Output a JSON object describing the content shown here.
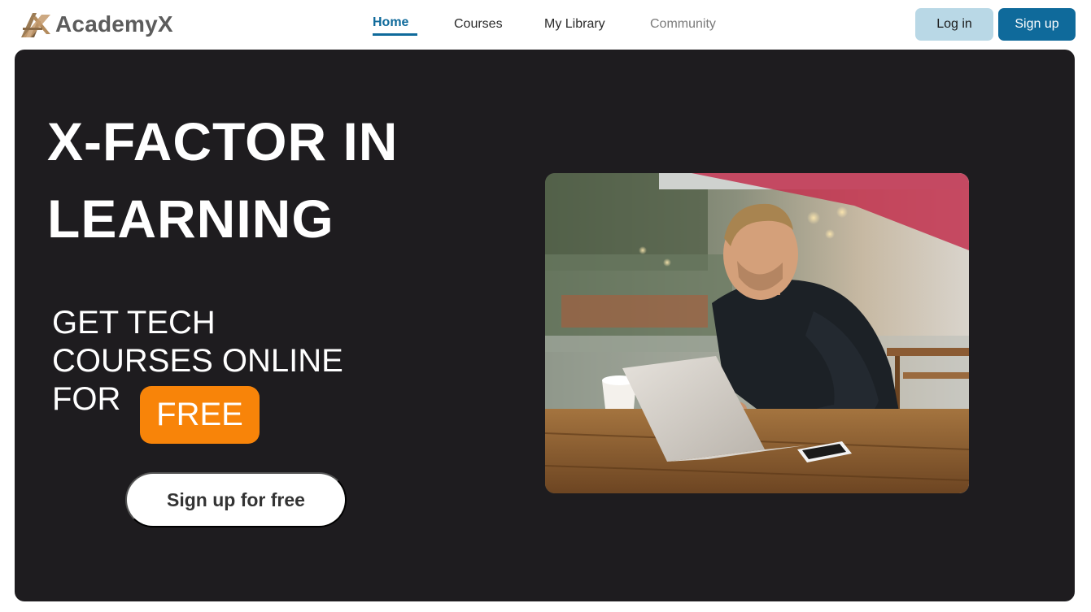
{
  "brand": {
    "name": "AcademyX",
    "logo_icon": "academyx-logo-icon"
  },
  "nav": {
    "items": [
      {
        "label": "Home",
        "state": "active"
      },
      {
        "label": "Courses",
        "state": "normal"
      },
      {
        "label": "My Library",
        "state": "normal"
      },
      {
        "label": "Community",
        "state": "muted"
      }
    ]
  },
  "auth": {
    "login_label": "Log in",
    "signup_label": "Sign up"
  },
  "hero": {
    "title_lines": [
      "X-FACTOR IN",
      "LEARNING"
    ],
    "subtitle_lines": [
      "GET TECH",
      "COURSES ONLINE",
      "FOR"
    ],
    "badge": "FREE",
    "cta_label": "Sign up for free",
    "image_subject": "man-with-laptop-photo"
  },
  "colors": {
    "primary": "#0f6a9b",
    "login_bg": "#b9d8e6",
    "hero_bg": "#1e1c1f",
    "badge_bg": "#f88409",
    "brand_text": "#5c5c5c"
  }
}
